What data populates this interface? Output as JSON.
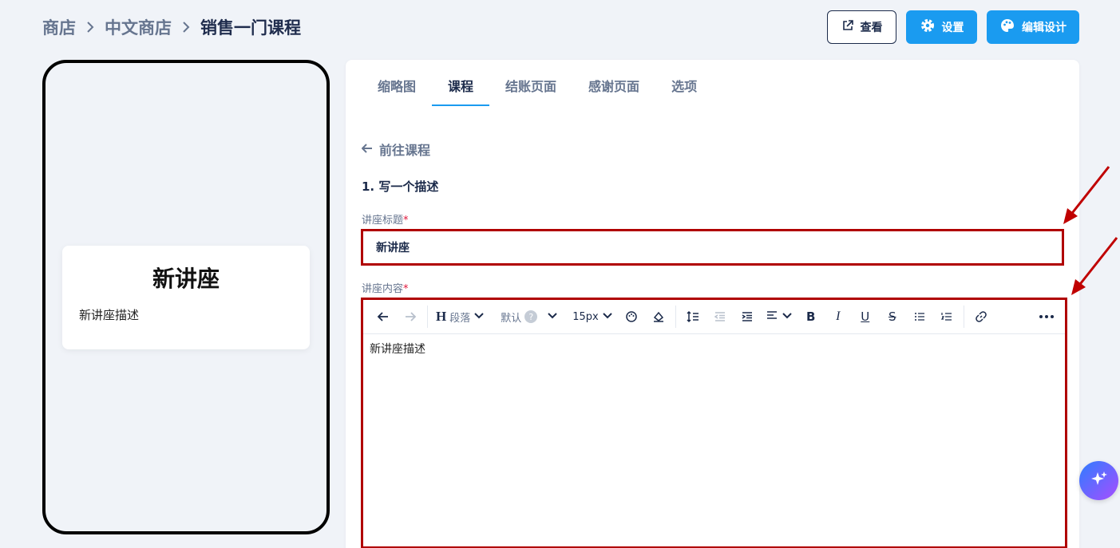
{
  "breadcrumb": {
    "items": [
      "商店",
      "中文商店",
      "销售一门课程"
    ]
  },
  "actions": {
    "view_label": "查看",
    "settings_label": "设置",
    "design_label": "编辑设计"
  },
  "preview": {
    "title": "新讲座",
    "description": "新讲座描述"
  },
  "tabs": [
    {
      "label": "缩略图",
      "active": false
    },
    {
      "label": "课程",
      "active": true
    },
    {
      "label": "结账页面",
      "active": false
    },
    {
      "label": "感谢页面",
      "active": false
    },
    {
      "label": "选项",
      "active": false
    }
  ],
  "form": {
    "back_label": "前往课程",
    "section_title": "1. 写一个描述",
    "title_label": "讲座标题",
    "title_value": "新讲座",
    "content_label": "讲座内容",
    "required_mark": "*",
    "content_value": "新讲座描述"
  },
  "toolbar": {
    "paragraph_label": "段落",
    "font_label": "默认",
    "font_help": "?",
    "size_label": "15px"
  },
  "colors": {
    "accent": "#1a9bf0",
    "highlight_border": "#b00000",
    "annotation_arrow": "#c00000"
  }
}
